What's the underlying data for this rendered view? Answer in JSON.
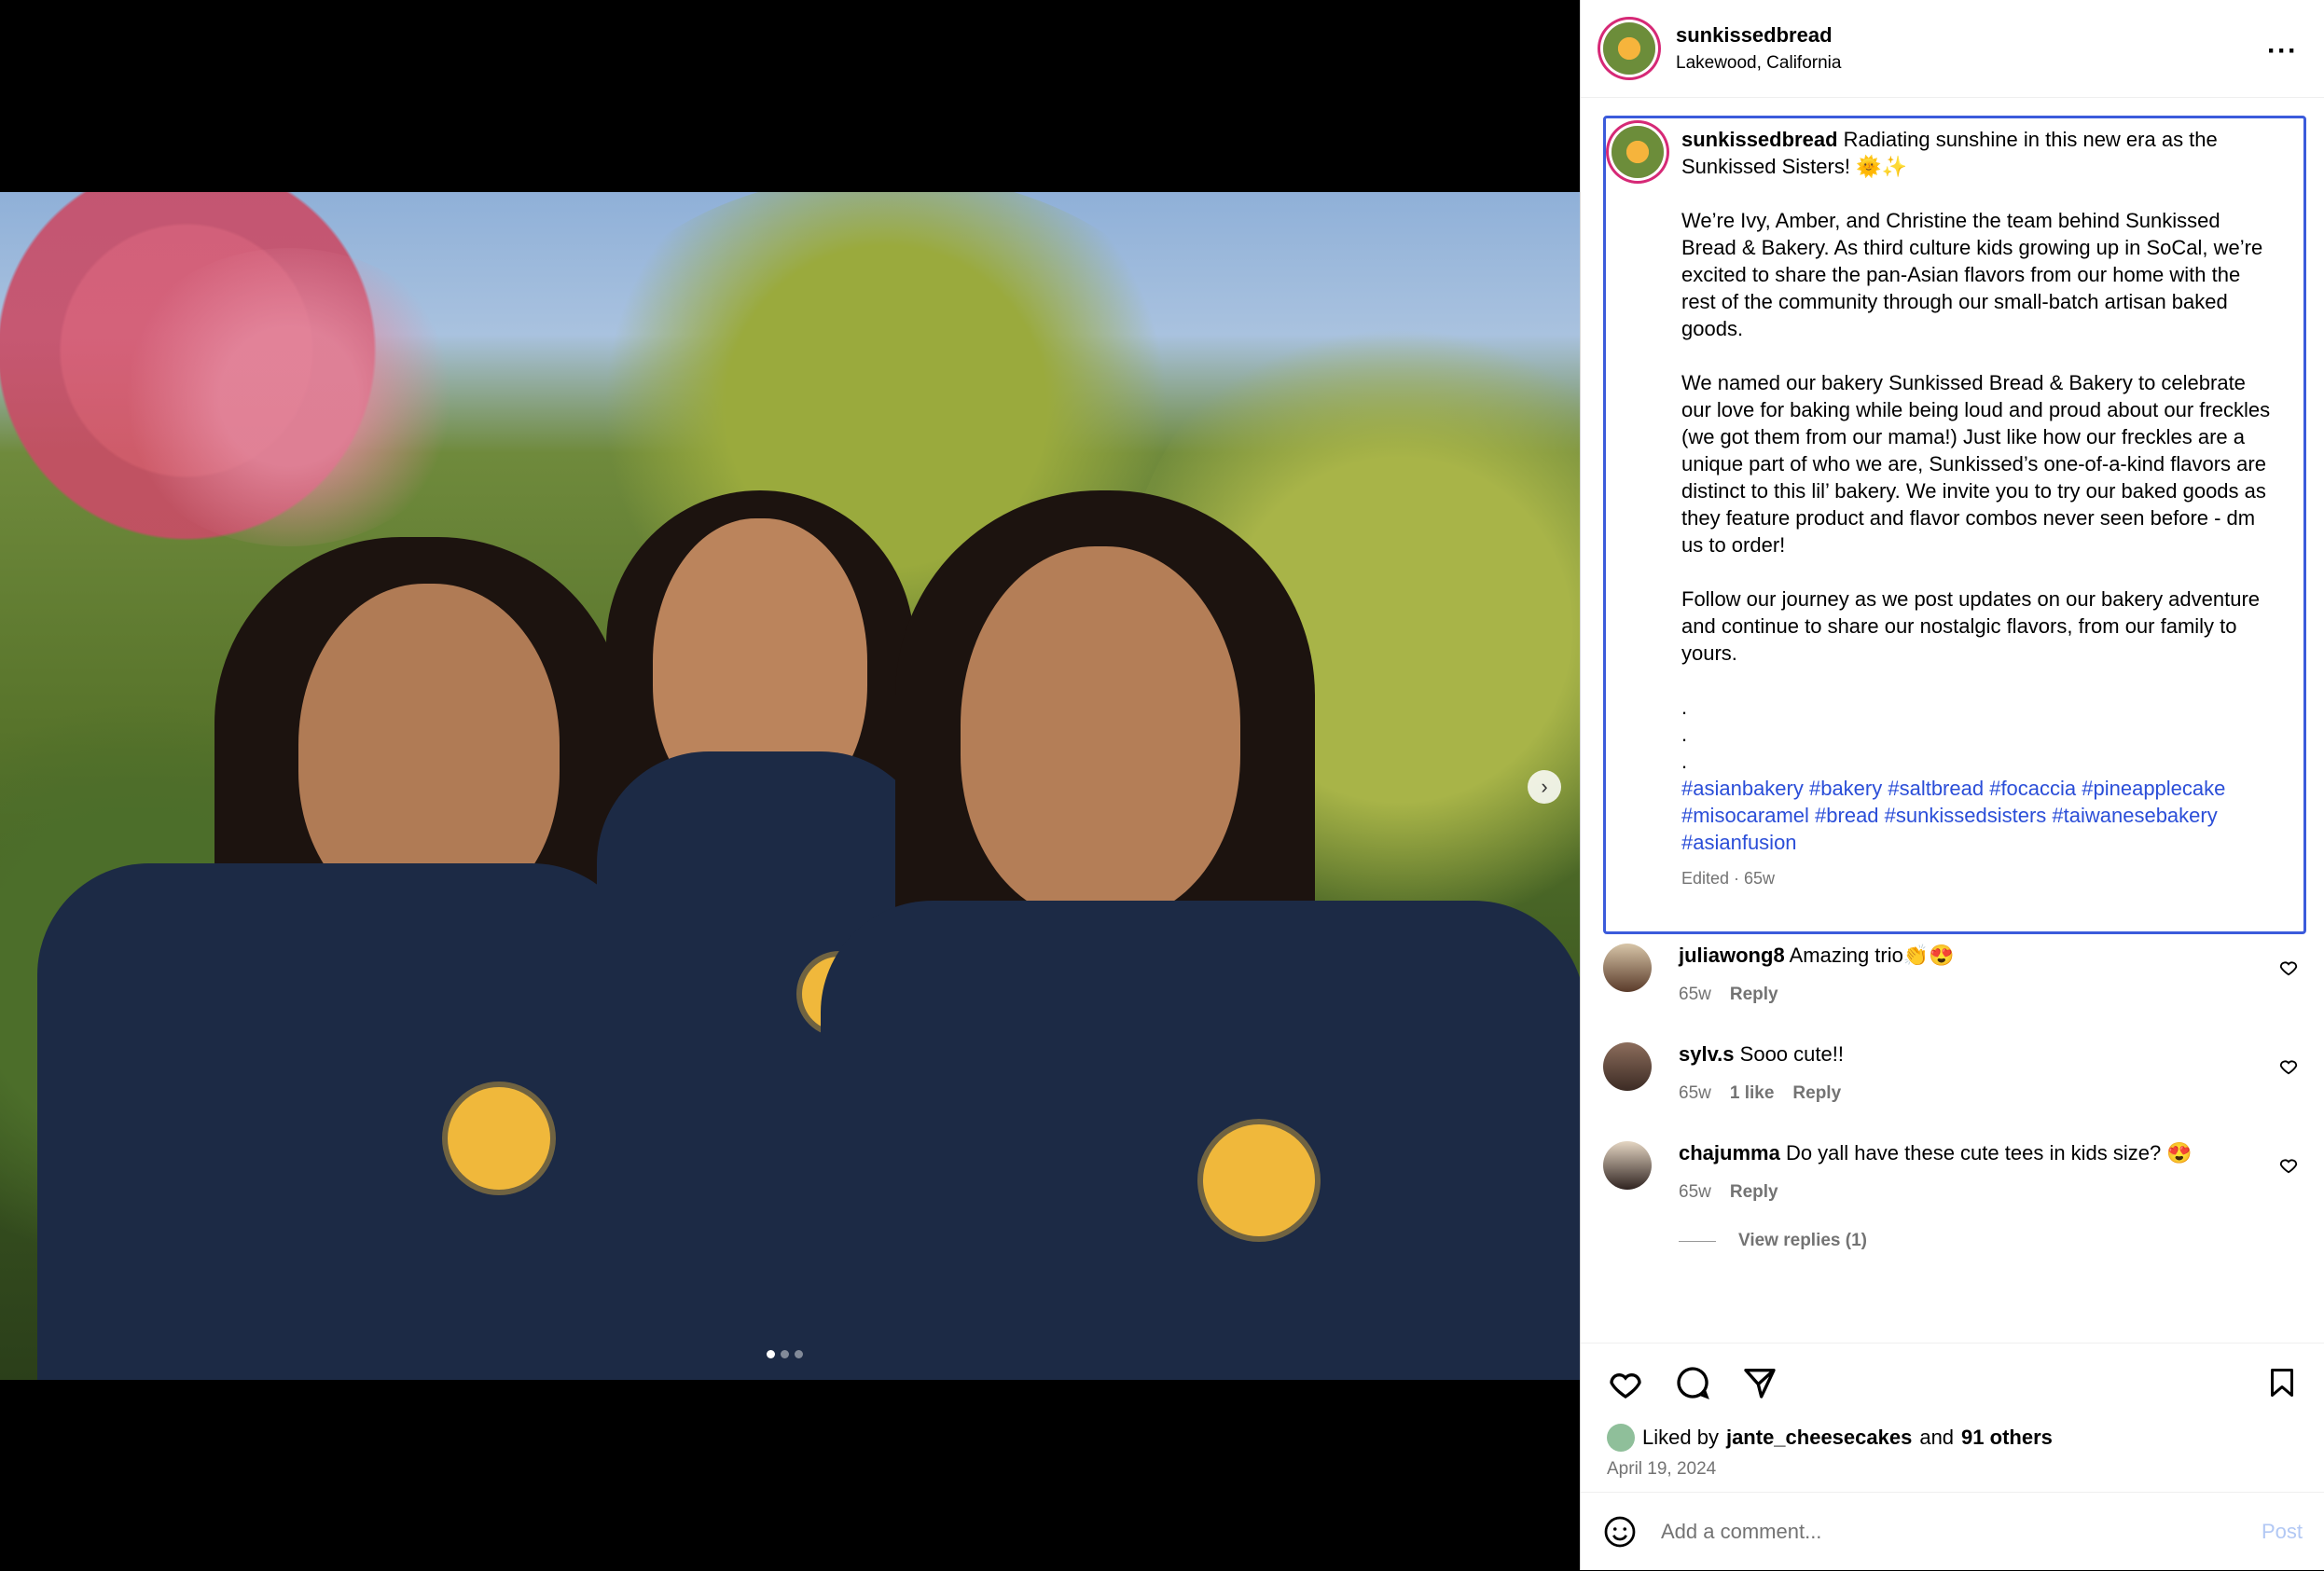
{
  "header": {
    "username": "sunkissedbread",
    "location": "Lakewood, California",
    "more": "···"
  },
  "caption": {
    "username": "sunkissedbread",
    "text": " Radiating sunshine in this new era as the Sunkissed Sisters! 🌞✨\n\nWe’re Ivy, Amber, and Christine the team behind Sunkissed Bread & Bakery. As third culture kids growing up in SoCal, we’re excited to share the pan-Asian flavors from our home with the rest of the community through our small-batch artisan baked goods.\n\nWe named our bakery Sunkissed Bread & Bakery to celebrate our love for baking while being loud and proud about our freckles (we got them from our mama!) Just like how our freckles are a unique part of who we are, Sunkissed’s one-of-a-kind flavors are distinct to this lil’ bakery. We invite you to try our baked goods as they feature product and flavor combos never seen before - dm us to order!\n\nFollow our journey as we post updates on our bakery adventure and continue to share our nostalgic flavors, from our family to yours.\n\n.\n.\n.\n",
    "hashtags": "#asianbakery #bakery #saltbread #focaccia #pineapplecake #misocaramel #bread #sunkissedsisters #taiwanesebakery #asianfusion",
    "meta": "Edited · 65w"
  },
  "comments": [
    {
      "user": "juliawong8",
      "text": " Amazing trio👏😍",
      "time": "65w",
      "likes": "",
      "reply": "Reply"
    },
    {
      "user": "sylv.s",
      "text": " Sooo cute!!",
      "time": "65w",
      "likes": "1 like",
      "reply": "Reply"
    },
    {
      "user": "chajumma",
      "text": " Do yall have these cute tees in kids size? 😍",
      "time": "65w",
      "likes": "",
      "reply": "Reply"
    }
  ],
  "view_replies": "View replies (1)",
  "likes": {
    "prefix": "Liked by ",
    "user": "jante_cheesecakes",
    "mid": " and ",
    "others": "91 others"
  },
  "date": "April 19, 2024",
  "add_comment": {
    "placeholder": "Add a comment...",
    "post": "Post"
  },
  "carousel": {
    "total": 3,
    "active": 1
  }
}
